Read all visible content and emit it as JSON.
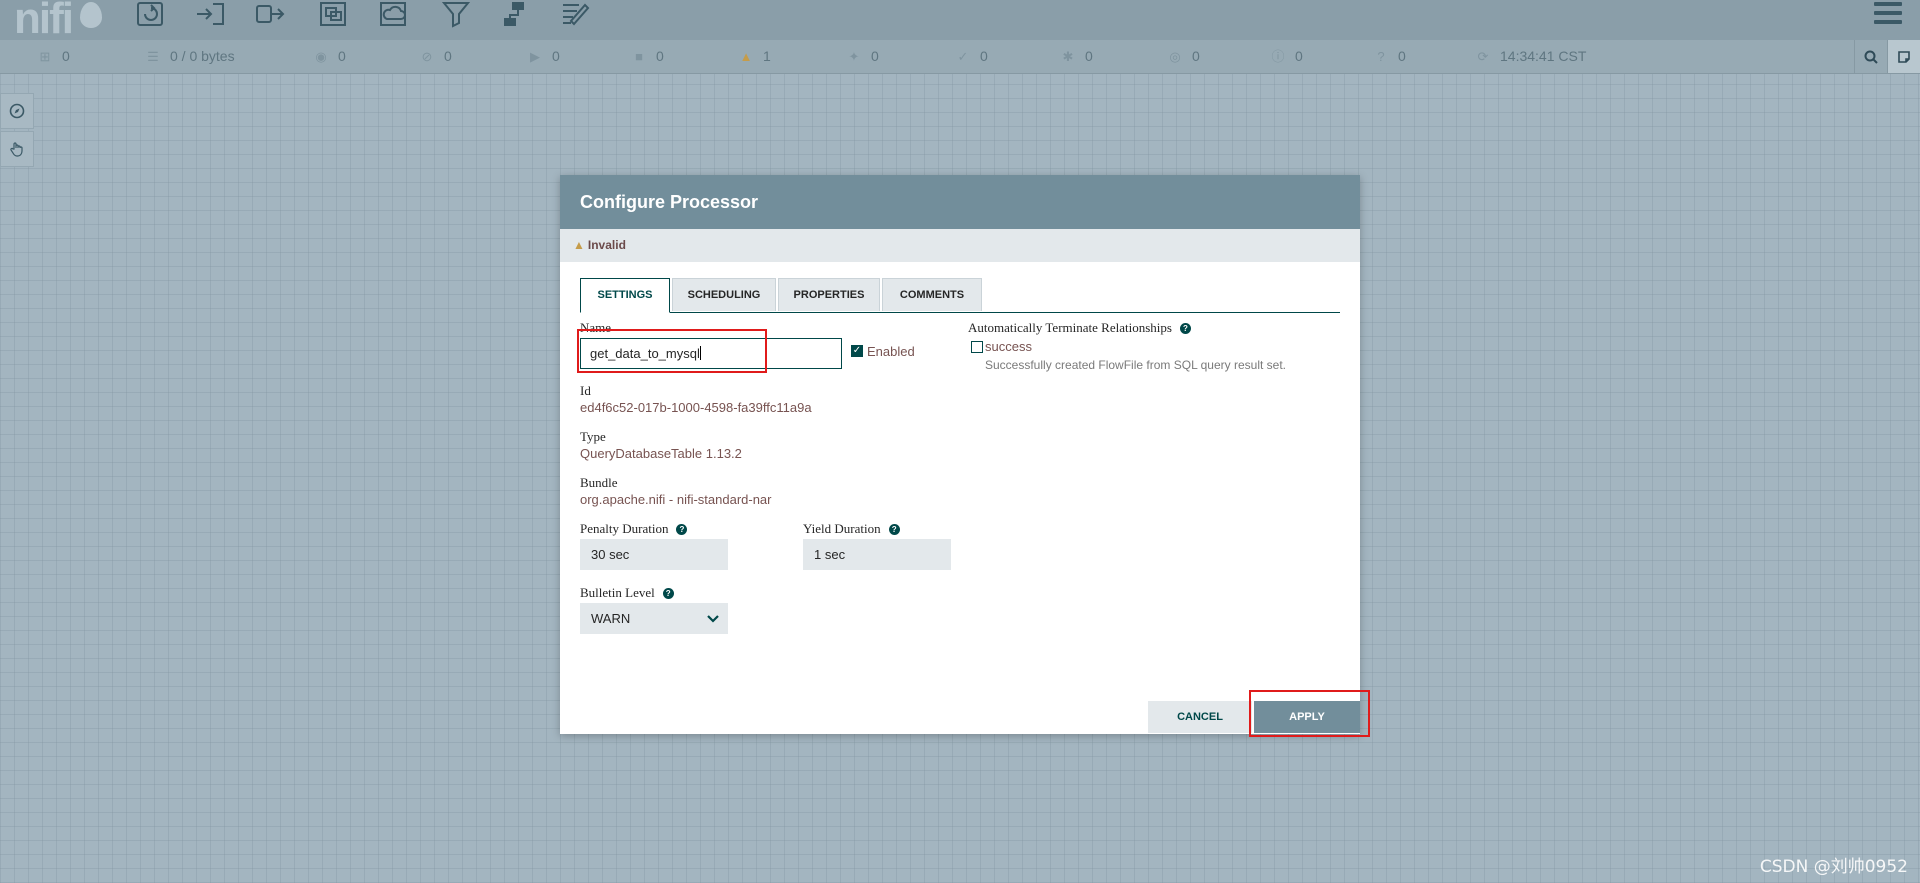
{
  "app": {
    "logo_text": "nifi"
  },
  "toolbar": {
    "icons": [
      "processor-icon",
      "input-port-icon",
      "output-port-icon",
      "process-group-icon",
      "remote-process-group-icon",
      "funnel-icon",
      "template-icon",
      "label-icon"
    ],
    "menu_icon": "hamburger-menu-icon"
  },
  "statusbar": {
    "items": [
      {
        "icon": "cluster-icon",
        "value": "0"
      },
      {
        "icon": "queue-icon",
        "value": "0 / 0 bytes"
      },
      {
        "icon": "transmitting-icon",
        "value": "0"
      },
      {
        "icon": "not-transmitting-icon",
        "value": "0"
      },
      {
        "icon": "running-icon",
        "value": "0"
      },
      {
        "icon": "stopped-icon",
        "value": "0"
      },
      {
        "icon": "invalid-warning-icon",
        "value": "1"
      },
      {
        "icon": "disabled-icon",
        "value": "0"
      },
      {
        "icon": "up-to-date-icon",
        "value": "0"
      },
      {
        "icon": "locally-modified-icon",
        "value": "0"
      },
      {
        "icon": "stale-icon",
        "value": "0"
      },
      {
        "icon": "locally-modified-stale-icon",
        "value": "0"
      },
      {
        "icon": "sync-failure-icon",
        "value": "0"
      }
    ],
    "refresh_time": "14:34:41 CST"
  },
  "dialog": {
    "title": "Configure Processor",
    "status": "Invalid",
    "tabs": [
      {
        "label": "SETTINGS",
        "active": true
      },
      {
        "label": "SCHEDULING",
        "active": false
      },
      {
        "label": "PROPERTIES",
        "active": false
      },
      {
        "label": "COMMENTS",
        "active": false
      }
    ],
    "name_label": "Name",
    "name_value": "get_data_to_mysql",
    "enabled_label": "Enabled",
    "enabled": true,
    "id_label": "Id",
    "id_value": "ed4f6c52-017b-1000-4598-fa39ffc11a9a",
    "type_label": "Type",
    "type_value": "QueryDatabaseTable 1.13.2",
    "bundle_label": "Bundle",
    "bundle_value": "org.apache.nifi - nifi-standard-nar",
    "penalty_label": "Penalty Duration",
    "penalty_value": "30 sec",
    "yield_label": "Yield Duration",
    "yield_value": "1 sec",
    "bulletin_label": "Bulletin Level",
    "bulletin_value": "WARN",
    "relationships_label": "Automatically Terminate Relationships",
    "relationship_name": "success",
    "relationship_desc": "Successfully created FlowFile from SQL query result set.",
    "cancel_label": "CANCEL",
    "apply_label": "APPLY"
  },
  "watermark": "CSDN @刘帅0952",
  "colors": {
    "accent": "#004849",
    "header": "#728e9b",
    "value_text": "#775351",
    "highlight": "#e01b1b"
  }
}
